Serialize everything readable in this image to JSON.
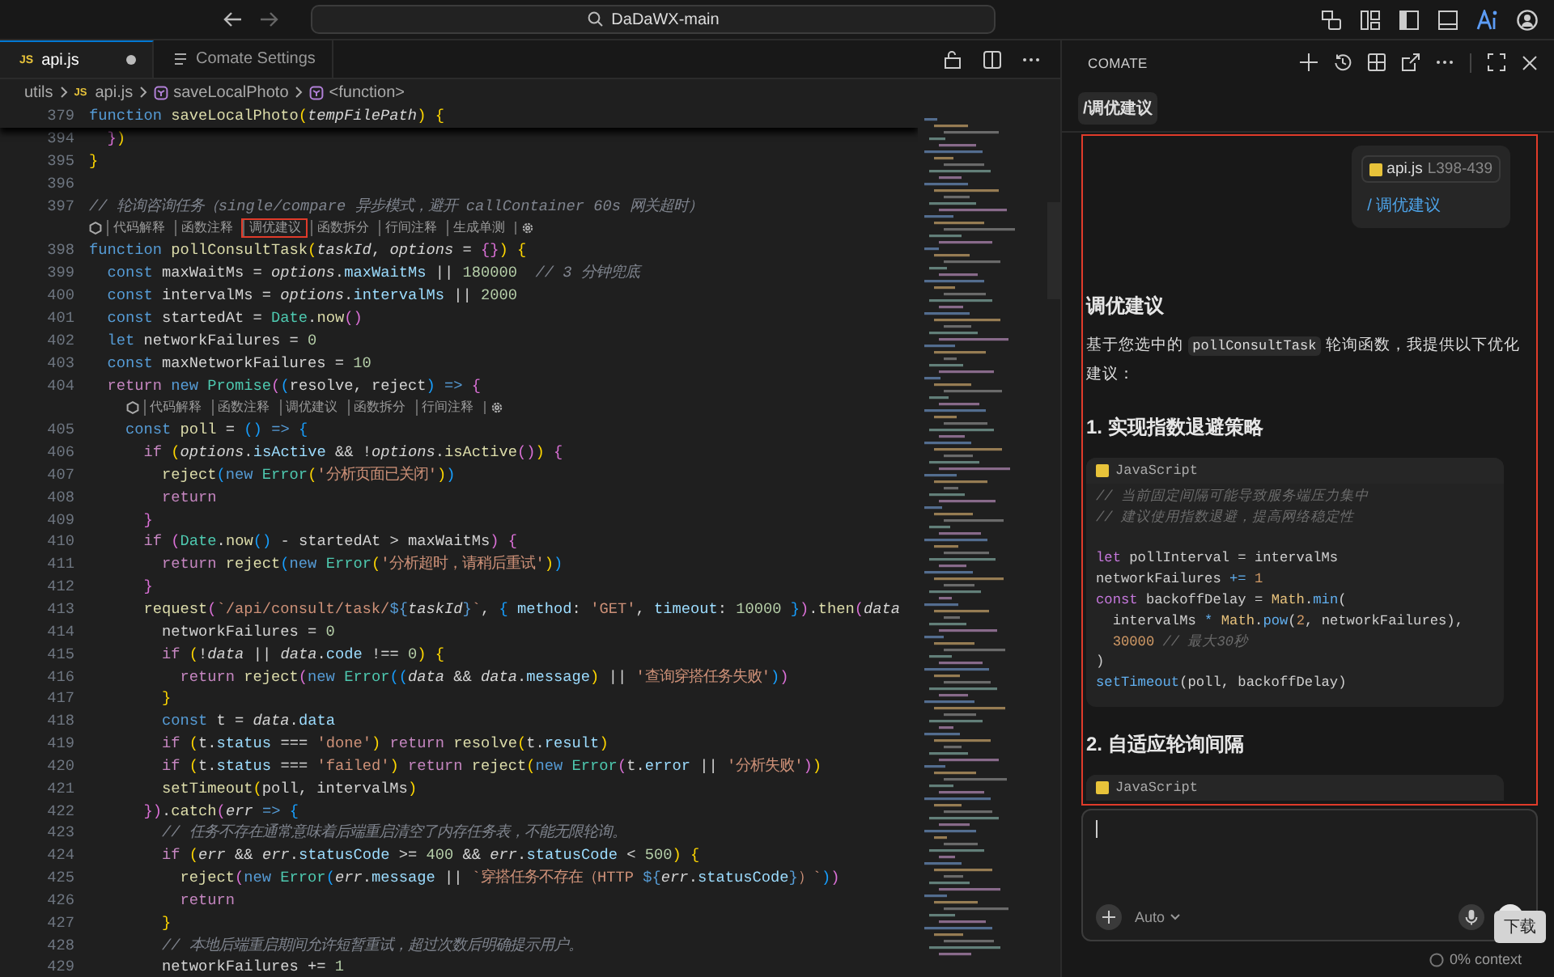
{
  "search": {
    "value": "DaDaWX-main"
  },
  "tabs": [
    {
      "label": "api.js",
      "kind": "file",
      "badge": "JS",
      "modified": true,
      "selected": true
    },
    {
      "label": "Comate Settings",
      "kind": "settings",
      "modified": false,
      "selected": false
    }
  ],
  "breadcrumb": [
    {
      "label": "utils",
      "kind": "folder"
    },
    {
      "label": "api.js",
      "kind": "file",
      "badge": "JS"
    },
    {
      "label": "saveLocalPhoto",
      "kind": "symbol"
    },
    {
      "label": "<function>",
      "kind": "symbol"
    }
  ],
  "sticky_line": {
    "number": "379",
    "tokens": [
      {
        "kind": "kw",
        "t": "function "
      },
      {
        "kind": "fn",
        "t": "saveLocalPhoto"
      },
      {
        "kind": "y",
        "t": "("
      },
      {
        "kind": "it",
        "t": "tempFilePath"
      },
      {
        "kind": "y",
        "t": ") "
      },
      {
        "kind": "y",
        "t": "{"
      }
    ]
  },
  "lines": [
    {
      "kind": "code",
      "number": "394",
      "tokens": [
        {
          "kind": "m",
          "t": "  }"
        },
        {
          "kind": "y",
          "t": ")"
        }
      ]
    },
    {
      "kind": "code",
      "number": "395",
      "tokens": [
        {
          "kind": "y",
          "t": "}"
        }
      ]
    },
    {
      "kind": "code",
      "number": "396"
    },
    {
      "kind": "code",
      "number": "397",
      "tokens": [
        {
          "kind": "c",
          "t": "// 轮询咨询任务（single/compare 异步模式，避开 callContainer 60s 网关超时）"
        }
      ]
    },
    {
      "kind": "lens",
      "indented": false,
      "items": [
        {
          "label": "代码解释",
          "highlighted": false
        },
        {
          "label": "函数注释",
          "highlighted": false
        },
        {
          "label": "调优建议",
          "highlighted": true
        },
        {
          "label": "函数拆分",
          "highlighted": false
        },
        {
          "label": "行间注释",
          "highlighted": false
        },
        {
          "label": "生成单测",
          "highlighted": false
        }
      ]
    },
    {
      "kind": "code",
      "number": "398",
      "tokens": [
        {
          "kind": "kw",
          "t": "function "
        },
        {
          "kind": "fn",
          "t": "pollConsultTask"
        },
        {
          "kind": "y",
          "t": "("
        },
        {
          "kind": "it",
          "t": "taskId"
        },
        {
          "kind": "p",
          "t": ", "
        },
        {
          "kind": "it",
          "t": "options"
        },
        {
          "kind": "p",
          "t": " = "
        },
        {
          "kind": "m",
          "t": "{}"
        },
        {
          "kind": "y",
          "t": ") "
        },
        {
          "kind": "y",
          "t": "{"
        }
      ]
    },
    {
      "kind": "code",
      "number": "399",
      "tokens": [
        {
          "kind": "kw",
          "t": "  const "
        },
        {
          "kind": "p",
          "t": "maxWaitMs = "
        },
        {
          "kind": "it",
          "t": "options"
        },
        {
          "kind": "p",
          "t": "."
        },
        {
          "kind": "pr",
          "t": "maxWaitMs"
        },
        {
          "kind": "p",
          "t": " || "
        },
        {
          "kind": "n",
          "t": "180000  "
        },
        {
          "kind": "c",
          "t": "// 3 分钟兜底"
        }
      ]
    },
    {
      "kind": "code",
      "number": "400",
      "tokens": [
        {
          "kind": "kw",
          "t": "  const "
        },
        {
          "kind": "p",
          "t": "intervalMs = "
        },
        {
          "kind": "it",
          "t": "options"
        },
        {
          "kind": "p",
          "t": "."
        },
        {
          "kind": "pr",
          "t": "intervalMs"
        },
        {
          "kind": "p",
          "t": " || "
        },
        {
          "kind": "n",
          "t": "2000"
        }
      ]
    },
    {
      "kind": "code",
      "number": "401",
      "tokens": [
        {
          "kind": "kw",
          "t": "  const "
        },
        {
          "kind": "p",
          "t": "startedAt = "
        },
        {
          "kind": "cl",
          "t": "Date"
        },
        {
          "kind": "p",
          "t": "."
        },
        {
          "kind": "fn",
          "t": "now"
        },
        {
          "kind": "m",
          "t": "()"
        }
      ]
    },
    {
      "kind": "code",
      "number": "402",
      "tokens": [
        {
          "kind": "kw",
          "t": "  let "
        },
        {
          "kind": "p",
          "t": "networkFailures = "
        },
        {
          "kind": "n",
          "t": "0"
        }
      ]
    },
    {
      "kind": "code",
      "number": "403",
      "tokens": [
        {
          "kind": "kw",
          "t": "  const "
        },
        {
          "kind": "p",
          "t": "maxNetworkFailures = "
        },
        {
          "kind": "n",
          "t": "10"
        }
      ]
    },
    {
      "kind": "code",
      "number": "404",
      "tokens": [
        {
          "kind": "ct",
          "t": "  return "
        },
        {
          "kind": "kw",
          "t": "new "
        },
        {
          "kind": "cl",
          "t": "Promise"
        },
        {
          "kind": "m",
          "t": "("
        },
        {
          "kind": "b",
          "t": "("
        },
        {
          "kind": "p",
          "t": "resolve, reject"
        },
        {
          "kind": "b",
          "t": ") "
        },
        {
          "kind": "kw",
          "t": "=> "
        },
        {
          "kind": "m",
          "t": "{"
        }
      ]
    },
    {
      "kind": "lens",
      "indented": true,
      "items": [
        {
          "label": "代码解释",
          "highlighted": false
        },
        {
          "label": "函数注释",
          "highlighted": false
        },
        {
          "label": "调优建议",
          "highlighted": false
        },
        {
          "label": "函数拆分",
          "highlighted": false
        },
        {
          "label": "行间注释",
          "highlighted": false
        }
      ]
    },
    {
      "kind": "code",
      "number": "405",
      "tokens": [
        {
          "kind": "kw",
          "t": "    const "
        },
        {
          "kind": "fn",
          "t": "poll"
        },
        {
          "kind": "p",
          "t": " = "
        },
        {
          "kind": "b",
          "t": "() "
        },
        {
          "kind": "kw",
          "t": "=> "
        },
        {
          "kind": "b",
          "t": "{"
        }
      ]
    },
    {
      "kind": "code",
      "number": "406",
      "tokens": [
        {
          "kind": "ct",
          "t": "      if "
        },
        {
          "kind": "y",
          "t": "("
        },
        {
          "kind": "it",
          "t": "options"
        },
        {
          "kind": "p",
          "t": "."
        },
        {
          "kind": "pr",
          "t": "isActive"
        },
        {
          "kind": "p",
          "t": " && !"
        },
        {
          "kind": "it",
          "t": "options"
        },
        {
          "kind": "p",
          "t": "."
        },
        {
          "kind": "fn",
          "t": "isActive"
        },
        {
          "kind": "m",
          "t": "()"
        },
        {
          "kind": "y",
          "t": ") "
        },
        {
          "kind": "m",
          "t": "{"
        }
      ]
    },
    {
      "kind": "code",
      "number": "407",
      "tokens": [
        {
          "kind": "fn",
          "t": "        reject"
        },
        {
          "kind": "b",
          "t": "("
        },
        {
          "kind": "kw",
          "t": "new "
        },
        {
          "kind": "cl",
          "t": "Error"
        },
        {
          "kind": "y",
          "t": "("
        },
        {
          "kind": "s",
          "t": "'分析页面已关闭'"
        },
        {
          "kind": "y",
          "t": ")"
        },
        {
          "kind": "b",
          "t": ")"
        }
      ]
    },
    {
      "kind": "code",
      "number": "408",
      "tokens": [
        {
          "kind": "ct",
          "t": "        return"
        }
      ]
    },
    {
      "kind": "code",
      "number": "409",
      "tokens": [
        {
          "kind": "m",
          "t": "      }"
        }
      ]
    },
    {
      "kind": "code",
      "number": "410",
      "tokens": [
        {
          "kind": "ct",
          "t": "      if "
        },
        {
          "kind": "m",
          "t": "("
        },
        {
          "kind": "cl",
          "t": "Date"
        },
        {
          "kind": "p",
          "t": "."
        },
        {
          "kind": "fn",
          "t": "now"
        },
        {
          "kind": "b",
          "t": "()"
        },
        {
          "kind": "p",
          "t": " - startedAt > maxWaitMs"
        },
        {
          "kind": "m",
          "t": ") "
        },
        {
          "kind": "m",
          "t": "{"
        }
      ]
    },
    {
      "kind": "code",
      "number": "411",
      "tokens": [
        {
          "kind": "ct",
          "t": "        return "
        },
        {
          "kind": "fn",
          "t": "reject"
        },
        {
          "kind": "b",
          "t": "("
        },
        {
          "kind": "kw",
          "t": "new "
        },
        {
          "kind": "cl",
          "t": "Error"
        },
        {
          "kind": "y",
          "t": "("
        },
        {
          "kind": "s",
          "t": "'分析超时，请稍后重试'"
        },
        {
          "kind": "y",
          "t": ")"
        },
        {
          "kind": "b",
          "t": ")"
        }
      ]
    },
    {
      "kind": "code",
      "number": "412",
      "tokens": [
        {
          "kind": "m",
          "t": "      }"
        }
      ]
    },
    {
      "kind": "code",
      "number": "413",
      "tokens": [
        {
          "kind": "fn",
          "t": "      request"
        },
        {
          "kind": "m",
          "t": "("
        },
        {
          "kind": "s",
          "t": "`/api/consult/task/"
        },
        {
          "kind": "kw",
          "t": "${"
        },
        {
          "kind": "it",
          "t": "taskId"
        },
        {
          "kind": "kw",
          "t": "}"
        },
        {
          "kind": "s",
          "t": "`"
        },
        {
          "kind": "p",
          "t": ", "
        },
        {
          "kind": "b",
          "t": "{ "
        },
        {
          "kind": "pr",
          "t": "method"
        },
        {
          "kind": "p",
          "t": ": "
        },
        {
          "kind": "s",
          "t": "'GET'"
        },
        {
          "kind": "p",
          "t": ", "
        },
        {
          "kind": "pr",
          "t": "timeout"
        },
        {
          "kind": "p",
          "t": ": "
        },
        {
          "kind": "n",
          "t": "10000"
        },
        {
          "kind": "b",
          "t": " }"
        },
        {
          "kind": "m",
          "t": ")"
        },
        {
          "kind": "p",
          "t": "."
        },
        {
          "kind": "fn",
          "t": "then"
        },
        {
          "kind": "m",
          "t": "("
        },
        {
          "kind": "it",
          "t": "data"
        }
      ]
    },
    {
      "kind": "code",
      "number": "414",
      "tokens": [
        {
          "kind": "p",
          "t": "        networkFailures = "
        },
        {
          "kind": "n",
          "t": "0"
        }
      ]
    },
    {
      "kind": "code",
      "number": "415",
      "tokens": [
        {
          "kind": "ct",
          "t": "        if "
        },
        {
          "kind": "y",
          "t": "("
        },
        {
          "kind": "p",
          "t": "!"
        },
        {
          "kind": "it",
          "t": "data"
        },
        {
          "kind": "p",
          "t": " || "
        },
        {
          "kind": "it",
          "t": "data"
        },
        {
          "kind": "p",
          "t": "."
        },
        {
          "kind": "pr",
          "t": "code"
        },
        {
          "kind": "p",
          "t": " !== "
        },
        {
          "kind": "n",
          "t": "0"
        },
        {
          "kind": "y",
          "t": ") "
        },
        {
          "kind": "y",
          "t": "{"
        }
      ]
    },
    {
      "kind": "code",
      "number": "416",
      "tokens": [
        {
          "kind": "ct",
          "t": "          return "
        },
        {
          "kind": "fn",
          "t": "reject"
        },
        {
          "kind": "m",
          "t": "("
        },
        {
          "kind": "kw",
          "t": "new "
        },
        {
          "kind": "cl",
          "t": "Error"
        },
        {
          "kind": "b",
          "t": "(("
        },
        {
          "kind": "it",
          "t": "data"
        },
        {
          "kind": "p",
          "t": " && "
        },
        {
          "kind": "it",
          "t": "data"
        },
        {
          "kind": "p",
          "t": "."
        },
        {
          "kind": "pr",
          "t": "message"
        },
        {
          "kind": "y",
          "t": ")"
        },
        {
          "kind": "p",
          "t": " || "
        },
        {
          "kind": "s",
          "t": "'查询穿搭任务失败'"
        },
        {
          "kind": "b",
          "t": ")"
        },
        {
          "kind": "m",
          "t": ")"
        }
      ]
    },
    {
      "kind": "code",
      "number": "417",
      "tokens": [
        {
          "kind": "y",
          "t": "        }"
        }
      ]
    },
    {
      "kind": "code",
      "number": "418",
      "tokens": [
        {
          "kind": "kw",
          "t": "        const "
        },
        {
          "kind": "p",
          "t": "t = "
        },
        {
          "kind": "it",
          "t": "data"
        },
        {
          "kind": "p",
          "t": "."
        },
        {
          "kind": "pr",
          "t": "data"
        }
      ]
    },
    {
      "kind": "code",
      "number": "419",
      "tokens": [
        {
          "kind": "ct",
          "t": "        if "
        },
        {
          "kind": "y",
          "t": "("
        },
        {
          "kind": "p",
          "t": "t."
        },
        {
          "kind": "pr",
          "t": "status"
        },
        {
          "kind": "p",
          "t": " === "
        },
        {
          "kind": "s",
          "t": "'done'"
        },
        {
          "kind": "y",
          "t": ") "
        },
        {
          "kind": "ct",
          "t": "return "
        },
        {
          "kind": "fn",
          "t": "resolve"
        },
        {
          "kind": "y",
          "t": "("
        },
        {
          "kind": "p",
          "t": "t."
        },
        {
          "kind": "pr",
          "t": "result"
        },
        {
          "kind": "y",
          "t": ")"
        }
      ]
    },
    {
      "kind": "code",
      "number": "420",
      "tokens": [
        {
          "kind": "ct",
          "t": "        if "
        },
        {
          "kind": "y",
          "t": "("
        },
        {
          "kind": "p",
          "t": "t."
        },
        {
          "kind": "pr",
          "t": "status"
        },
        {
          "kind": "p",
          "t": " === "
        },
        {
          "kind": "s",
          "t": "'failed'"
        },
        {
          "kind": "y",
          "t": ") "
        },
        {
          "kind": "ct",
          "t": "return "
        },
        {
          "kind": "fn",
          "t": "reject"
        },
        {
          "kind": "y",
          "t": "("
        },
        {
          "kind": "kw",
          "t": "new "
        },
        {
          "kind": "cl",
          "t": "Error"
        },
        {
          "kind": "m",
          "t": "("
        },
        {
          "kind": "p",
          "t": "t."
        },
        {
          "kind": "pr",
          "t": "error"
        },
        {
          "kind": "p",
          "t": " || "
        },
        {
          "kind": "s",
          "t": "'分析失败'"
        },
        {
          "kind": "m",
          "t": ")"
        },
        {
          "kind": "y",
          "t": ")"
        }
      ]
    },
    {
      "kind": "code",
      "number": "421",
      "tokens": [
        {
          "kind": "fn",
          "t": "        setTimeout"
        },
        {
          "kind": "y",
          "t": "("
        },
        {
          "kind": "p",
          "t": "poll, intervalMs"
        },
        {
          "kind": "y",
          "t": ")"
        }
      ]
    },
    {
      "kind": "code",
      "number": "422",
      "tokens": [
        {
          "kind": "m",
          "t": "      })"
        },
        {
          "kind": "p",
          "t": "."
        },
        {
          "kind": "fn",
          "t": "catch"
        },
        {
          "kind": "m",
          "t": "("
        },
        {
          "kind": "it",
          "t": "err "
        },
        {
          "kind": "kw",
          "t": "=> "
        },
        {
          "kind": "b",
          "t": "{"
        }
      ]
    },
    {
      "kind": "code",
      "number": "423",
      "tokens": [
        {
          "kind": "c",
          "t": "        // 任务不存在通常意味着后端重启清空了内存任务表，不能无限轮询。"
        }
      ]
    },
    {
      "kind": "code",
      "number": "424",
      "tokens": [
        {
          "kind": "ct",
          "t": "        if "
        },
        {
          "kind": "y",
          "t": "("
        },
        {
          "kind": "it",
          "t": "err"
        },
        {
          "kind": "p",
          "t": " && "
        },
        {
          "kind": "it",
          "t": "err"
        },
        {
          "kind": "p",
          "t": "."
        },
        {
          "kind": "pr",
          "t": "statusCode"
        },
        {
          "kind": "p",
          "t": " >= "
        },
        {
          "kind": "n",
          "t": "400"
        },
        {
          "kind": "p",
          "t": " && "
        },
        {
          "kind": "it",
          "t": "err"
        },
        {
          "kind": "p",
          "t": "."
        },
        {
          "kind": "pr",
          "t": "statusCode"
        },
        {
          "kind": "p",
          "t": " < "
        },
        {
          "kind": "n",
          "t": "500"
        },
        {
          "kind": "y",
          "t": ") "
        },
        {
          "kind": "y",
          "t": "{"
        }
      ]
    },
    {
      "kind": "code",
      "number": "425",
      "tokens": [
        {
          "kind": "fn",
          "t": "          reject"
        },
        {
          "kind": "m",
          "t": "("
        },
        {
          "kind": "kw",
          "t": "new "
        },
        {
          "kind": "cl",
          "t": "Error"
        },
        {
          "kind": "b",
          "t": "("
        },
        {
          "kind": "it",
          "t": "err"
        },
        {
          "kind": "p",
          "t": "."
        },
        {
          "kind": "pr",
          "t": "message"
        },
        {
          "kind": "p",
          "t": " || "
        },
        {
          "kind": "s",
          "t": "`穿搭任务不存在（HTTP "
        },
        {
          "kind": "kw",
          "t": "${"
        },
        {
          "kind": "it",
          "t": "err"
        },
        {
          "kind": "p",
          "t": "."
        },
        {
          "kind": "pr",
          "t": "statusCode"
        },
        {
          "kind": "kw",
          "t": "}"
        },
        {
          "kind": "s",
          "t": "）`"
        },
        {
          "kind": "b",
          "t": ")"
        },
        {
          "kind": "m",
          "t": ")"
        }
      ]
    },
    {
      "kind": "code",
      "number": "426",
      "tokens": [
        {
          "kind": "ct",
          "t": "          return"
        }
      ]
    },
    {
      "kind": "code",
      "number": "427",
      "tokens": [
        {
          "kind": "y",
          "t": "        }"
        }
      ]
    },
    {
      "kind": "code",
      "number": "428",
      "tokens": [
        {
          "kind": "c",
          "t": "        // 本地后端重启期间允许短暂重试，超过次数后明确提示用户。"
        }
      ]
    },
    {
      "kind": "code",
      "number": "429",
      "tokens": [
        {
          "kind": "p",
          "t": "        networkFailures += "
        },
        {
          "kind": "n",
          "t": "1"
        }
      ]
    }
  ],
  "panel": {
    "title": "COMATE",
    "command_chip": "/调优建议",
    "highlighted": true,
    "request": {
      "file": "api.js",
      "range": "L398-439",
      "command": "/ 调优建议"
    },
    "blocks": [
      {
        "kind": "heading",
        "text": "调优建议"
      },
      {
        "kind": "paragraph",
        "parts": [
          {
            "kind": "text",
            "t": "基于您选中的 "
          },
          {
            "kind": "code",
            "t": "pollConsultTask"
          },
          {
            "kind": "text",
            "t": " 轮询函数，我提供以下优化建议："
          }
        ]
      },
      {
        "kind": "subheading",
        "text": "1. 实现指数退避策略"
      },
      {
        "kind": "code",
        "language": "JavaScript",
        "lines": [
          {
            "tokens": [
              {
                "kind": "c",
                "t": "// 当前固定间隔可能导致服务端压力集中"
              }
            ]
          },
          {
            "tokens": [
              {
                "kind": "c",
                "t": "// 建议使用指数退避，提高网络稳定性"
              }
            ]
          },
          {
            "kind": "blank"
          },
          {
            "tokens": [
              {
                "kind": "kw",
                "t": "let "
              },
              {
                "kind": "p",
                "t": "pollInterval = intervalMs"
              }
            ]
          },
          {
            "tokens": [
              {
                "kind": "p",
                "t": "networkFailures "
              },
              {
                "kind": "op",
                "t": "+= "
              },
              {
                "kind": "n",
                "t": "1"
              }
            ]
          },
          {
            "tokens": [
              {
                "kind": "kw",
                "t": "const "
              },
              {
                "kind": "p",
                "t": "backoffDelay = "
              },
              {
                "kind": "cl",
                "t": "Math"
              },
              {
                "kind": "p",
                "t": "."
              },
              {
                "kind": "fn",
                "t": "min"
              },
              {
                "kind": "p",
                "t": "("
              }
            ]
          },
          {
            "tokens": [
              {
                "kind": "p",
                "t": "  intervalMs "
              },
              {
                "kind": "op",
                "t": "* "
              },
              {
                "kind": "cl",
                "t": "Math"
              },
              {
                "kind": "p",
                "t": "."
              },
              {
                "kind": "fn",
                "t": "pow"
              },
              {
                "kind": "p",
                "t": "("
              },
              {
                "kind": "n",
                "t": "2"
              },
              {
                "kind": "p",
                "t": ", networkFailures),"
              }
            ]
          },
          {
            "tokens": [
              {
                "kind": "n",
                "t": "  30000 "
              },
              {
                "kind": "c",
                "t": "// 最大30秒"
              }
            ]
          },
          {
            "tokens": [
              {
                "kind": "p",
                "t": ")"
              }
            ]
          },
          {
            "tokens": [
              {
                "kind": "fn",
                "t": "setTimeout"
              },
              {
                "kind": "p",
                "t": "(poll, backoffDelay)"
              }
            ]
          }
        ]
      },
      {
        "kind": "subheading",
        "text": "2. 自适应轮询间隔"
      },
      {
        "kind": "code",
        "language": "JavaScript"
      }
    ]
  },
  "input": {
    "mode": "Auto",
    "tooltip": "下载",
    "context": "0% context"
  }
}
